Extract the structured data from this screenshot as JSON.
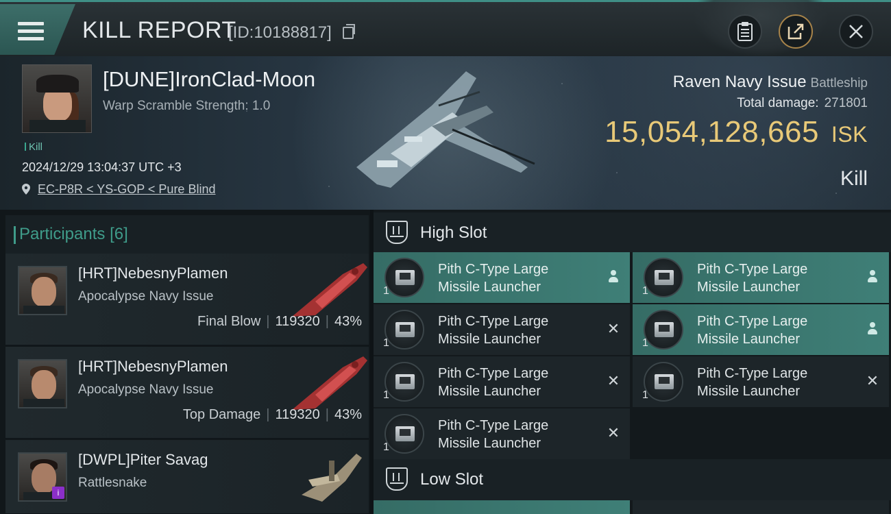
{
  "header": {
    "title": "KILL REPORT",
    "id_text": "[ID:10188817]",
    "buttons": [
      "clipboard-icon",
      "share-icon",
      "close-icon"
    ]
  },
  "victim": {
    "name": "[DUNE]IronClad-Moon",
    "warp": "Warp Scramble Strength: 1.0",
    "tag": "Kill",
    "timestamp": "2024/12/29 13:04:37 UTC +3",
    "location": "EC-P8R < YS-GOP < Pure Blind",
    "ship": "Raven Navy Issue",
    "ship_class": "Battleship",
    "damage_label": "Total damage:",
    "damage_value": "271801",
    "isk_value": "15,054,128,665",
    "isk_unit": "ISK",
    "result": "Kill"
  },
  "participants": {
    "label": "Participants",
    "count": "[6]",
    "rows": [
      {
        "name": "[HRT]NebesnyPlamen",
        "ship": "Apocalypse Navy Issue",
        "role": "Final Blow",
        "damage": "119320",
        "pct": "43%"
      },
      {
        "name": "[HRT]NebesnyPlamen",
        "ship": "Apocalypse Navy Issue",
        "role": "Top Damage",
        "damage": "119320",
        "pct": "43%"
      },
      {
        "name": "[DWPL]Piter Savag",
        "ship": "Rattlesnake",
        "role": "",
        "damage": "",
        "pct": ""
      }
    ]
  },
  "slots": {
    "high_label": "High Slot",
    "low_label": "Low Slot",
    "high": [
      {
        "name_line1": "Pith C-Type Large",
        "name_line2": "Missile Launcher",
        "qty": "1",
        "status": "dropped"
      },
      {
        "name_line1": "Pith C-Type Large",
        "name_line2": "Missile Launcher",
        "qty": "1",
        "status": "dropped"
      },
      {
        "name_line1": "Pith C-Type Large",
        "name_line2": "Missile Launcher",
        "qty": "1",
        "status": "destroyed"
      },
      {
        "name_line1": "Pith C-Type Large",
        "name_line2": "Missile Launcher",
        "qty": "1",
        "status": "dropped"
      },
      {
        "name_line1": "Pith C-Type Large",
        "name_line2": "Missile Launcher",
        "qty": "1",
        "status": "destroyed"
      },
      {
        "name_line1": "Pith C-Type Large",
        "name_line2": "Missile Launcher",
        "qty": "1",
        "status": "destroyed"
      },
      {
        "name_line1": "Pith C-Type Large",
        "name_line2": "Missile Launcher",
        "qty": "1",
        "status": "destroyed"
      }
    ]
  },
  "colors": {
    "accent": "#3f9c8a",
    "isk": "#e8c978",
    "dropped_bg": "#3f7f77",
    "badge": "#8b2fc9"
  }
}
